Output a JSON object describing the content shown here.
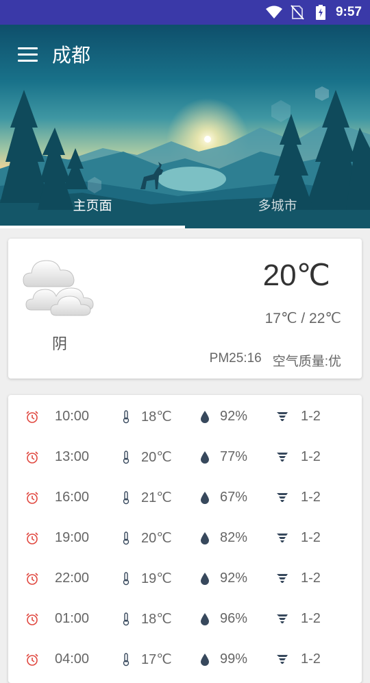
{
  "status_bar": {
    "time": "9:57",
    "icons": [
      "wifi-icon",
      "no-sim-icon",
      "battery-charging-icon"
    ]
  },
  "header": {
    "city": "成都",
    "menu_icon": "menu-icon"
  },
  "tabs": [
    {
      "label": "主页面",
      "active": true
    },
    {
      "label": "多城市",
      "active": false
    }
  ],
  "current": {
    "icon": "cloudy-icon",
    "condition": "阴",
    "temperature": "20℃",
    "range": "17℃ / 22℃",
    "pm25": "PM25:16",
    "air_quality": "空气质量:优"
  },
  "hourly": [
    {
      "time": "10:00",
      "temp": "18℃",
      "humidity": "92%",
      "wind": "1-2"
    },
    {
      "time": "13:00",
      "temp": "20℃",
      "humidity": "77%",
      "wind": "1-2"
    },
    {
      "time": "16:00",
      "temp": "21℃",
      "humidity": "67%",
      "wind": "1-2"
    },
    {
      "time": "19:00",
      "temp": "20℃",
      "humidity": "82%",
      "wind": "1-2"
    },
    {
      "time": "22:00",
      "temp": "19℃",
      "humidity": "92%",
      "wind": "1-2"
    },
    {
      "time": "01:00",
      "temp": "18℃",
      "humidity": "96%",
      "wind": "1-2"
    },
    {
      "time": "04:00",
      "temp": "17℃",
      "humidity": "99%",
      "wind": "1-2"
    }
  ],
  "colors": {
    "status_bar": "#3a39a8",
    "alarm": "#e0473f",
    "icon_dark": "#37485c",
    "text": "#666666"
  }
}
